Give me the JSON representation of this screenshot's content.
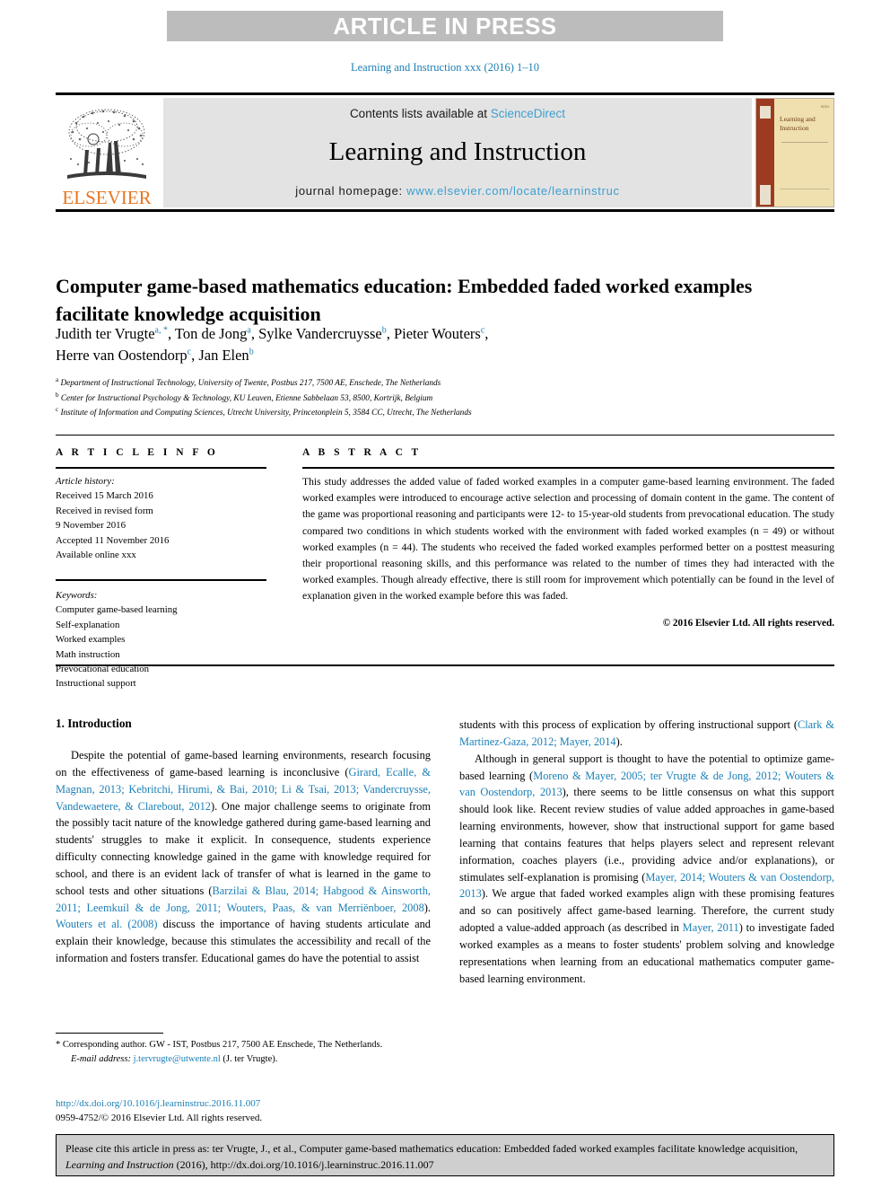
{
  "banner": {
    "text": "ARTICLE IN PRESS"
  },
  "journal_ref": "Learning and Instruction xxx (2016) 1–10",
  "masthead": {
    "contents_prefix": "Contents lists available at ",
    "sciencedirect": "ScienceDirect",
    "journal_name": "Learning and Instruction",
    "homepage_label": "journal homepage: ",
    "homepage_url": "www.elsevier.com/locate/learninstruc",
    "publisher": "ELSEVIER",
    "cover_title": "Learning and Instruction",
    "cover_topmark": "ISSN"
  },
  "article": {
    "title": "Computer game-based mathematics education: Embedded faded worked examples facilitate knowledge acquisition",
    "authors_line1_a": "Judith ter Vrugte",
    "authors_line1_a_sup": "a, *",
    "authors_line1_b": ", Ton de Jong",
    "authors_line1_b_sup": "a",
    "authors_line1_c": ", Sylke Vandercruysse",
    "authors_line1_c_sup": "b",
    "authors_line1_d": ", Pieter Wouters",
    "authors_line1_d_sup": "c",
    "authors_line1_end": ",",
    "authors_line2_a": "Herre van Oostendorp",
    "authors_line2_a_sup": "c",
    "authors_line2_b": ", Jan Elen",
    "authors_line2_b_sup": "b",
    "affiliations": [
      {
        "mark": "a",
        "text": "Department of Instructional Technology, University of Twente, Postbus 217, 7500 AE, Enschede, The Netherlands"
      },
      {
        "mark": "b",
        "text": "Center for Instructional Psychology & Technology, KU Leuven, Etienne Sabbelaan 53, 8500, Kortrijk, Belgium"
      },
      {
        "mark": "c",
        "text": "Institute of Information and Computing Sciences, Utrecht University, Princetonplein 5, 3584 CC, Utrecht, The Netherlands"
      }
    ]
  },
  "article_info": {
    "heading": "A R T I C L E   I N F O",
    "history_label": "Article history:",
    "history": [
      "Received 15 March 2016",
      "Received in revised form",
      "9 November 2016",
      "Accepted 11 November 2016",
      "Available online xxx"
    ],
    "keywords_label": "Keywords:",
    "keywords": [
      "Computer game-based learning",
      "Self-explanation",
      "Worked examples",
      "Math instruction",
      "Prevocational education",
      "Instructional support"
    ]
  },
  "abstract": {
    "heading": "A B S T R A C T",
    "text": "This study addresses the added value of faded worked examples in a computer game-based learning environment. The faded worked examples were introduced to encourage active selection and processing of domain content in the game. The content of the game was proportional reasoning and participants were 12- to 15-year-old students from prevocational education. The study compared two conditions in which students worked with the environment with faded worked examples (n = 49) or without worked examples (n = 44). The students who received the faded worked examples performed better on a posttest measuring their proportional reasoning skills, and this performance was related to the number of times they had interacted with the worked examples. Though already effective, there is still room for improvement which potentially can be found in the level of explanation given in the worked example before this was faded.",
    "copyright": "© 2016 Elsevier Ltd. All rights reserved."
  },
  "body": {
    "section_title": "1. Introduction",
    "left_paragraphs": [
      {
        "runs": [
          {
            "t": "Despite the potential of game-based learning environments, research focusing on the effectiveness of game-based learning is inconclusive (",
            "link": false
          },
          {
            "t": "Girard, Ecalle, & Magnan, 2013; Kebritchi, Hirumi, & Bai, 2010; Li & Tsai, 2013; Vandercruysse, Vandewaetere, & Clarebout, 2012",
            "link": true
          },
          {
            "t": "). One major challenge seems to originate from the possibly tacit nature of the knowledge gathered during game-based learning and students' struggles to make it explicit. In consequence, students experience difficulty connecting knowledge gained in the game with knowledge required for school, and there is an evident lack of transfer of what is learned in the game to school tests and other situations (",
            "link": false
          },
          {
            "t": "Barzilai & Blau, 2014; Habgood & Ainsworth, 2011; Leemkuil & de Jong, 2011; Wouters, Paas, & van Merriënboer, 2008",
            "link": true
          },
          {
            "t": "). ",
            "link": false
          },
          {
            "t": "Wouters et al. (2008)",
            "link": true
          },
          {
            "t": " discuss the importance of having students articulate and explain their knowledge, because this stimulates the accessibility and recall of the information and fosters transfer. Educational games do have the potential to assist",
            "link": false
          }
        ]
      }
    ],
    "right_paragraphs": [
      {
        "indent": false,
        "runs": [
          {
            "t": "students with this process of explication by offering instructional support (",
            "link": false
          },
          {
            "t": "Clark & Martinez-Gaza, 2012; Mayer, 2014",
            "link": true
          },
          {
            "t": ").",
            "link": false
          }
        ]
      },
      {
        "indent": true,
        "runs": [
          {
            "t": "Although in general support is thought to have the potential to optimize game-based learning (",
            "link": false
          },
          {
            "t": "Moreno & Mayer, 2005; ter Vrugte & de Jong, 2012; Wouters & van Oostendorp, 2013",
            "link": true
          },
          {
            "t": "), there seems to be little consensus on what this support should look like. Recent review studies of value added approaches in game-based learning environments, however, show that instructional support for game based learning that contains features that helps players select and represent relevant information, coaches players (i.e., providing advice and/or explanations), or stimulates self-explanation is promising (",
            "link": false
          },
          {
            "t": "Mayer, 2014; Wouters & van Oostendorp, 2013",
            "link": true
          },
          {
            "t": "). We argue that faded worked examples align with these promising features and so can positively affect game-based learning. Therefore, the current study adopted a value-added approach (as described in ",
            "link": false
          },
          {
            "t": "Mayer, 2011",
            "link": true
          },
          {
            "t": ") to investigate faded worked examples as a means to foster students' problem solving and knowledge representations when learning from an educational mathematics computer game-based learning environment.",
            "link": false
          }
        ]
      }
    ]
  },
  "footnote": {
    "corresponding": "* Corresponding author. GW - IST, Postbus 217, 7500 AE Enschede, The Netherlands.",
    "email_label": "E-mail address:",
    "email": "j.tervrugte@utwente.nl",
    "email_suffix": "(J. ter Vrugte).",
    "doi": "http://dx.doi.org/10.1016/j.learninstruc.2016.11.007",
    "issn": "0959-4752/© 2016 Elsevier Ltd. All rights reserved."
  },
  "citation_box": {
    "prefix": "Please cite this article in press as: ter Vrugte, J., et al., Computer game-based mathematics education: Embedded faded worked examples facilitate knowledge acquisition, ",
    "journal": "Learning and Instruction",
    "suffix": " (2016), http://dx.doi.org/10.1016/j.learninstruc.2016.11.007"
  },
  "colors": {
    "link_blue": "#1a7fb5",
    "sd_blue": "#3d9fd0",
    "elsevier_orange": "#e87722",
    "banner_gray": "#bcbcbc"
  }
}
